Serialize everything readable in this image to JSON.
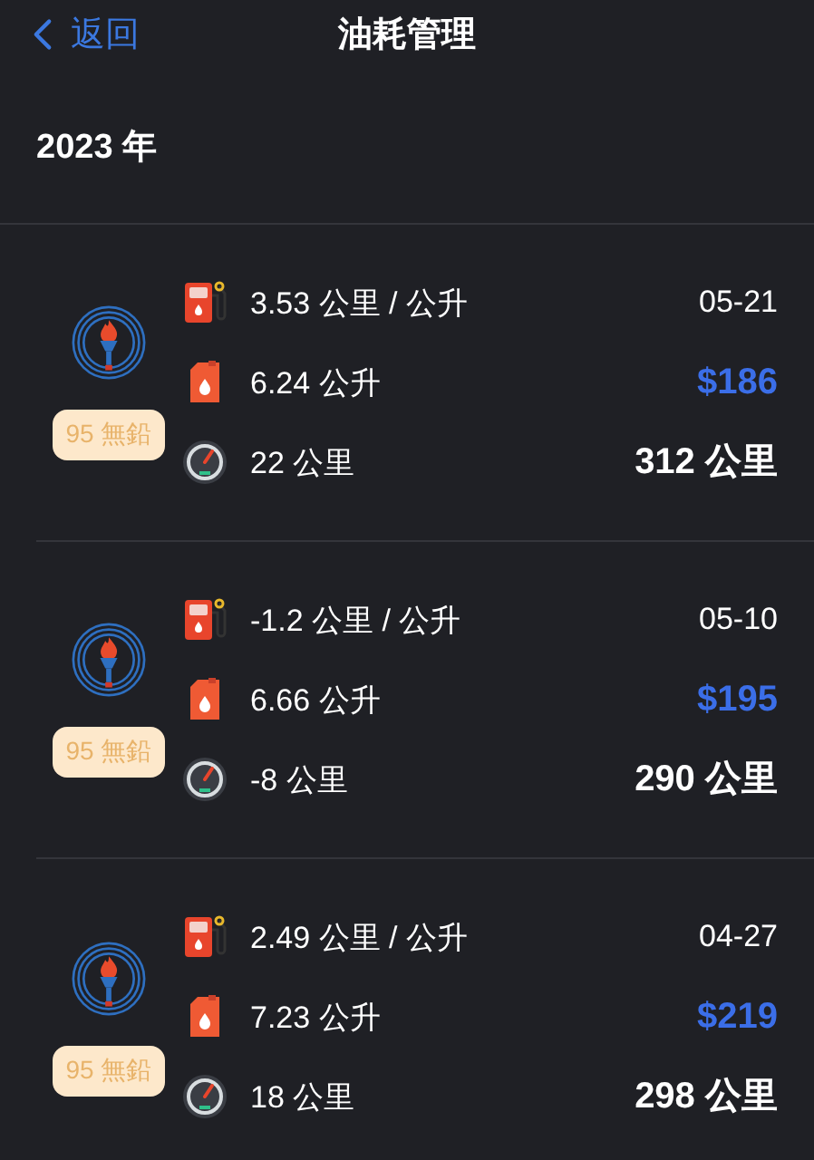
{
  "nav": {
    "back_label": "返回",
    "title": "油耗管理"
  },
  "year": "2023 年",
  "records": [
    {
      "grade": "95 無鉛",
      "efficiency": "3.53 公里 / 公升",
      "volume": "6.24 公升",
      "distance": "22 公里",
      "date": "05-21",
      "price": "$186",
      "odometer": "312 公里"
    },
    {
      "grade": "95 無鉛",
      "efficiency": "-1.2 公里 / 公升",
      "volume": "6.66 公升",
      "distance": "-8 公里",
      "date": "05-10",
      "price": "$195",
      "odometer": "290 公里"
    },
    {
      "grade": "95 無鉛",
      "efficiency": "2.49 公里 / 公升",
      "volume": "7.23 公升",
      "distance": "18 公里",
      "date": "04-27",
      "price": "$219",
      "odometer": "298 公里"
    }
  ]
}
